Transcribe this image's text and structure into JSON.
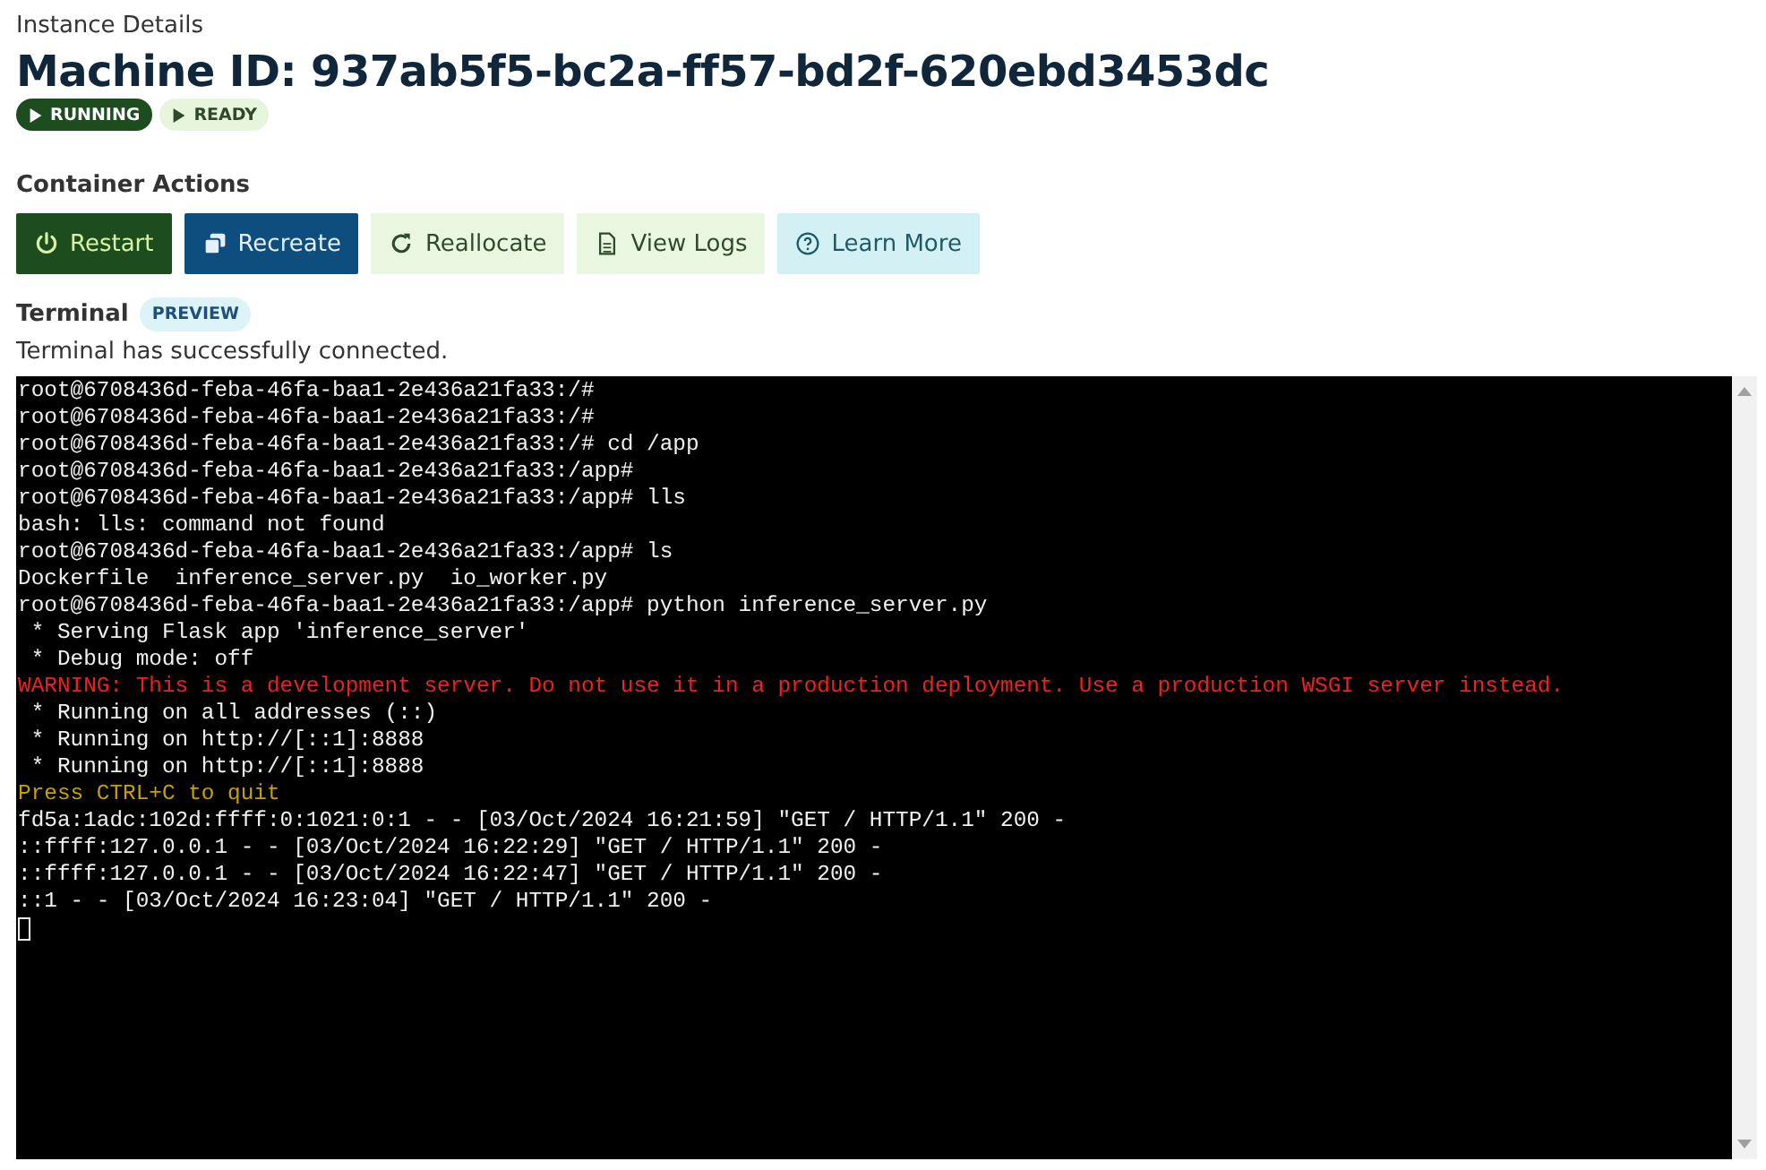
{
  "header": {
    "section_label": "Instance Details",
    "title": "Machine ID: 937ab5f5-bc2a-ff57-bd2f-620ebd3453dc"
  },
  "status_badges": [
    {
      "label": "RUNNING",
      "kind": "solid"
    },
    {
      "label": "READY",
      "kind": "soft"
    }
  ],
  "actions": {
    "title": "Container Actions",
    "buttons": [
      {
        "label": "Restart",
        "kind": "dark-green"
      },
      {
        "label": "Recreate",
        "kind": "dark-blue"
      },
      {
        "label": "Reallocate",
        "kind": "light-green"
      },
      {
        "label": "View Logs",
        "kind": "light-green"
      },
      {
        "label": "Learn More",
        "kind": "light-cyan"
      }
    ]
  },
  "terminal": {
    "title": "Terminal",
    "badge": "PREVIEW",
    "status": "Terminal has successfully connected.",
    "lines": [
      {
        "text": "root@6708436d-feba-46fa-baa1-2e436a21fa33:/#",
        "kind": "normal"
      },
      {
        "text": "root@6708436d-feba-46fa-baa1-2e436a21fa33:/#",
        "kind": "normal"
      },
      {
        "text": "root@6708436d-feba-46fa-baa1-2e436a21fa33:/# cd /app",
        "kind": "normal"
      },
      {
        "text": "root@6708436d-feba-46fa-baa1-2e436a21fa33:/app#",
        "kind": "normal"
      },
      {
        "text": "root@6708436d-feba-46fa-baa1-2e436a21fa33:/app# lls",
        "kind": "normal"
      },
      {
        "text": "bash: lls: command not found",
        "kind": "normal"
      },
      {
        "text": "root@6708436d-feba-46fa-baa1-2e436a21fa33:/app# ls",
        "kind": "normal"
      },
      {
        "text": "Dockerfile  inference_server.py  io_worker.py",
        "kind": "normal"
      },
      {
        "text": "root@6708436d-feba-46fa-baa1-2e436a21fa33:/app# python inference_server.py",
        "kind": "normal"
      },
      {
        "text": " * Serving Flask app 'inference_server'",
        "kind": "normal"
      },
      {
        "text": " * Debug mode: off",
        "kind": "normal"
      },
      {
        "text": "WARNING: This is a development server. Do not use it in a production deployment. Use a production WSGI server instead.",
        "kind": "error"
      },
      {
        "text": " * Running on all addresses (::)",
        "kind": "normal"
      },
      {
        "text": " * Running on http://[::1]:8888",
        "kind": "normal"
      },
      {
        "text": " * Running on http://[::1]:8888",
        "kind": "normal"
      },
      {
        "text": "Press CTRL+C to quit",
        "kind": "hint"
      },
      {
        "text": "fd5a:1adc:102d:ffff:0:1021:0:1 - - [03/Oct/2024 16:21:59] \"GET / HTTP/1.1\" 200 -",
        "kind": "normal"
      },
      {
        "text": "::ffff:127.0.0.1 - - [03/Oct/2024 16:22:29] \"GET / HTTP/1.1\" 200 -",
        "kind": "normal"
      },
      {
        "text": "::ffff:127.0.0.1 - - [03/Oct/2024 16:22:47] \"GET / HTTP/1.1\" 200 -",
        "kind": "normal"
      },
      {
        "text": "::1 - - [03/Oct/2024 16:23:04] \"GET / HTTP/1.1\" 200 -",
        "kind": "normal"
      }
    ]
  }
}
